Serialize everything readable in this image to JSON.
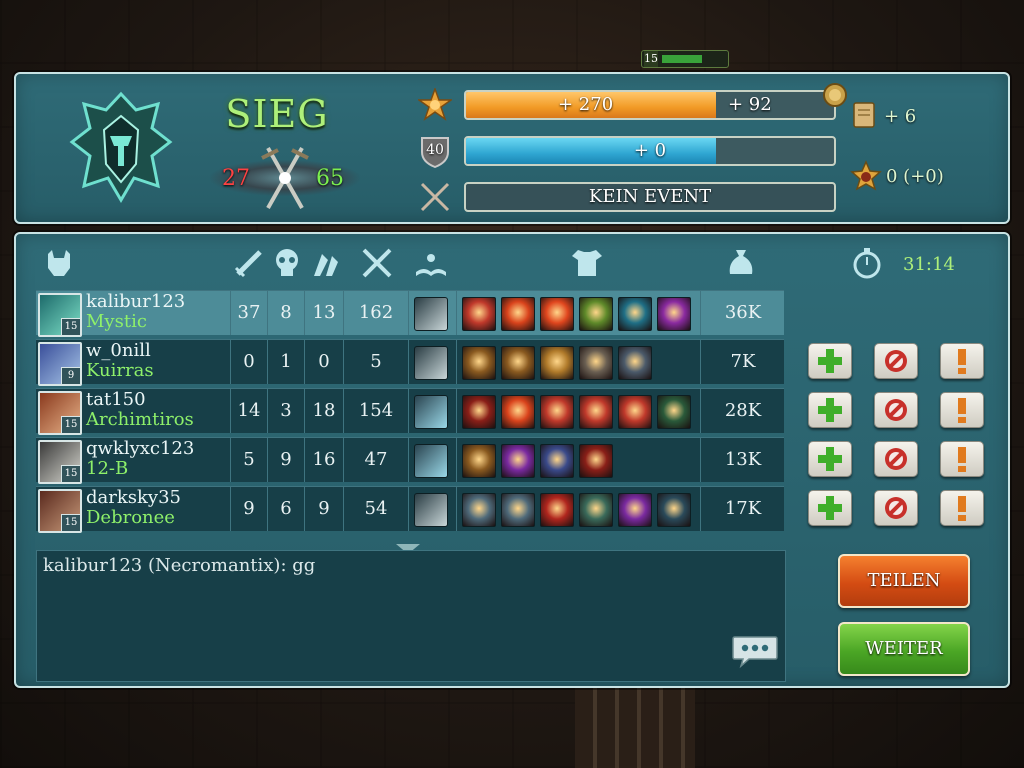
{
  "top_indicator": {
    "level": "15"
  },
  "summary": {
    "result": "SIEG",
    "score_enemy": "27",
    "score_team": "65",
    "xp_bar": {
      "gain": "+ 270",
      "bonus": "+ 92",
      "progress": 0.68,
      "bonus_progress": 0.0
    },
    "rank_bar": {
      "rank": "40",
      "gain": "+ 0",
      "progress": 0.68
    },
    "event_bar": {
      "label": "KEIN EVENT"
    },
    "rewards": {
      "cards": "+ 6",
      "medals": "0 (+0)"
    }
  },
  "table": {
    "timer": "31:14",
    "rows": [
      {
        "player": "kalibur123",
        "hero": "Mystic",
        "level": "15",
        "kills": "37",
        "deaths": "8",
        "assists": "13",
        "creeps": "162",
        "gold": "36K",
        "items": [
          "#c0392b",
          "#d9431c",
          "#e0461e",
          "#5f8a2a",
          "#1f6f86",
          "#8a2aa0"
        ]
      },
      {
        "player": "w_0nill",
        "hero": "Kuirras",
        "level": "9",
        "kills": "0",
        "deaths": "1",
        "assists": "0",
        "creeps": "5",
        "gold": "7K",
        "items": [
          "#8a5a20",
          "#8a5a20",
          "#b07a2a",
          "#6a5f52",
          "#4b5a6a"
        ]
      },
      {
        "player": "tat150",
        "hero": "Archimtiros",
        "level": "15",
        "kills": "14",
        "deaths": "3",
        "assists": "18",
        "creeps": "154",
        "gold": "28K",
        "items": [
          "#8a1f18",
          "#d9431c",
          "#c0392b",
          "#c0392b",
          "#c0392b",
          "#2a5a3a"
        ]
      },
      {
        "player": "qwklyxc123",
        "hero": "12-B",
        "level": "15",
        "kills": "5",
        "deaths": "9",
        "assists": "16",
        "creeps": "47",
        "gold": "13K",
        "items": [
          "#8a5a20",
          "#7a2aa0",
          "#3a4a8a",
          "#8a1f18"
        ]
      },
      {
        "player": "darksky35",
        "hero": "Debronee",
        "level": "15",
        "kills": "9",
        "deaths": "6",
        "assists": "9",
        "creeps": "54",
        "gold": "17K",
        "items": [
          "#4f6a7a",
          "#4f6a7a",
          "#b0261e",
          "#3a6a5a",
          "#7a2aa0",
          "#2a4a5a"
        ]
      }
    ]
  },
  "chat": {
    "message": "kalibur123 (Necromantix): gg"
  },
  "buttons": {
    "share": "TEILEN",
    "next": "WEITER"
  },
  "colors": {
    "panel": "#2f6b77",
    "accent_green": "#8ef06a",
    "xp_orange": "#f19a25",
    "rank_blue": "#2fa6d2"
  }
}
